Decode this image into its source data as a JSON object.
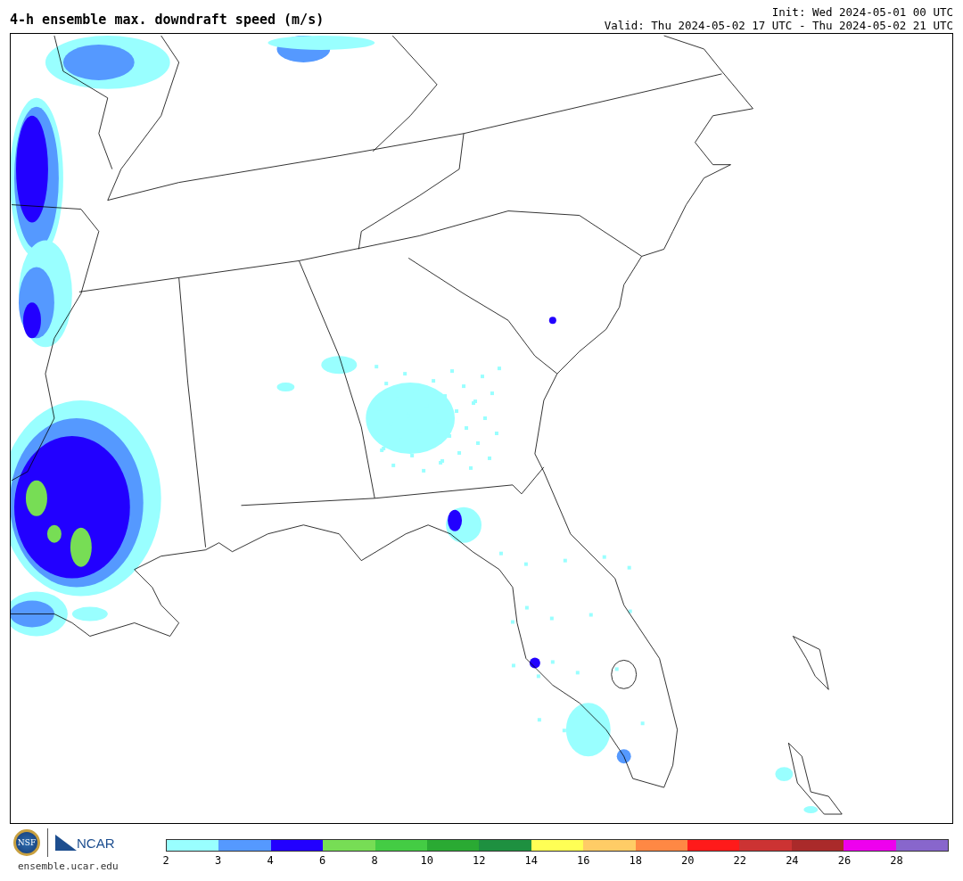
{
  "title": "4-h ensemble max. downdraft speed (m/s)",
  "init": "Init: Wed 2024-05-01 00 UTC",
  "valid": "Valid: Thu 2024-05-02 17 UTC - Thu 2024-05-02 21 UTC",
  "footer": {
    "nsf_logo_text": "NSF",
    "ncar_logo_text": "NCAR",
    "site": "ensemble.ucar.edu"
  },
  "colorbar": {
    "segments": [
      {
        "color": "#99ffff"
      },
      {
        "color": "#5599ff"
      },
      {
        "color": "#2200ff"
      },
      {
        "color": "#77dd55"
      },
      {
        "color": "#44cc44"
      },
      {
        "color": "#2aaa33"
      },
      {
        "color": "#1e9040"
      },
      {
        "color": "#ffff55"
      },
      {
        "color": "#ffcc66"
      },
      {
        "color": "#ff8844"
      },
      {
        "color": "#ff1a1a"
      },
      {
        "color": "#cc3333"
      },
      {
        "color": "#aa2a2a"
      },
      {
        "color": "#ee00ee"
      },
      {
        "color": "#8866cc"
      }
    ],
    "ticks": [
      "2",
      "3",
      "4",
      "6",
      "8",
      "10",
      "12",
      "14",
      "16",
      "18",
      "20",
      "22",
      "24",
      "26",
      "28"
    ]
  }
}
